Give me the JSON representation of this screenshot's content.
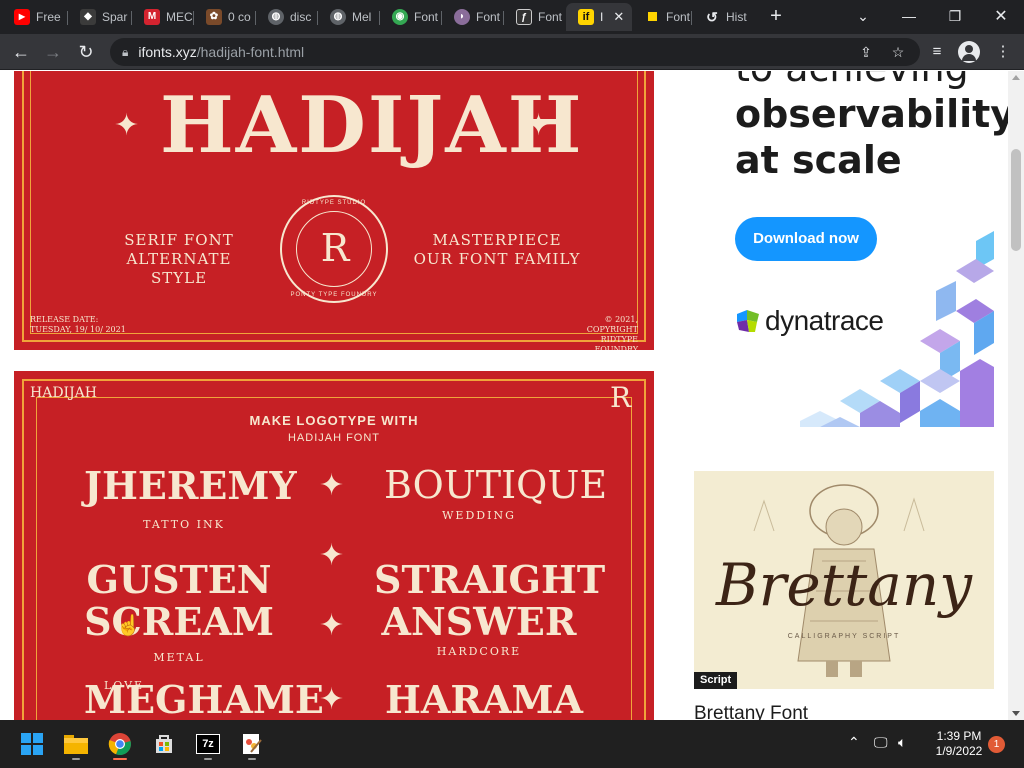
{
  "browser": {
    "tabs": [
      {
        "label": "Free",
        "favicon_color": "#ff0000",
        "favicon_glyph": "▶",
        "icon": "youtube-icon"
      },
      {
        "label": "Spar",
        "favicon_color": "#3b3b3b",
        "favicon_glyph": "◆",
        "icon": "helmet-icon"
      },
      {
        "label": "MEC",
        "favicon_color": "#d4232f",
        "favicon_glyph": "M",
        "icon": "m-logo-icon"
      },
      {
        "label": "0 co",
        "favicon_color": "#7a4a2a",
        "favicon_glyph": "✿",
        "icon": "cookie-icon"
      },
      {
        "label": "disc",
        "favicon_color": "#5f6368",
        "favicon_glyph": "◍",
        "icon": "globe-icon"
      },
      {
        "label": "Mel",
        "favicon_color": "#5f6368",
        "favicon_glyph": "◍",
        "icon": "globe-icon"
      },
      {
        "label": "Font",
        "favicon_color": "#34a853",
        "favicon_glyph": "◉",
        "icon": "maps-pin-icon"
      },
      {
        "label": "Font",
        "favicon_color": "#8a6d9a",
        "favicon_glyph": "◗",
        "icon": "font-site-icon"
      },
      {
        "label": "Font",
        "favicon_color": "#333333",
        "favicon_glyph": "ƒ",
        "icon": "font-site-icon"
      },
      {
        "label": "I",
        "favicon_color": "#ffd400",
        "favicon_glyph": "if",
        "icon": "ifonts-icon",
        "active": true
      },
      {
        "label": "Font",
        "favicon_color": "#ffd400",
        "favicon_glyph": "",
        "icon": "yellow-square-icon"
      },
      {
        "label": "Hist",
        "favicon_color": "#5f6368",
        "favicon_glyph": "↺",
        "icon": "history-icon"
      }
    ],
    "new_tab": "+",
    "url_host": "ifonts.xyz",
    "url_path": "/hadijah-font.html"
  },
  "page": {
    "banner1": {
      "title": "HADIJAH",
      "left_text": [
        "SERIF FONT",
        "ALTERNATE STYLE"
      ],
      "right_text": [
        "MASTERPIECE",
        "OUR FONT FAMILY"
      ],
      "seal_top": "RIDTYPE STUDIO",
      "seal_bottom": "PONTY TYPE FOUNDRY",
      "seal_mono": "R",
      "release": [
        "RELEASE DATE:",
        "TUESDAY, 19/ 10/ 2021"
      ],
      "copyright": [
        "© 2021, COPYRIGHT",
        "RIDTYPE FOUNDRY"
      ]
    },
    "banner2": {
      "corner": "HADIJAH",
      "mono": "R",
      "heading": "MAKE LOGOTYPE WITH",
      "subheading": "HADIJAH FONT",
      "logos": [
        {
          "name": "JHEREMY",
          "sub": "TATTO INK"
        },
        {
          "name": "BOUTIQUE",
          "sub": "WEDDING"
        },
        {
          "name": "GUSTEN",
          "sub": ""
        },
        {
          "name": "SCREAM",
          "sub": "METAL"
        },
        {
          "name": "STRAIGHT",
          "sub": ""
        },
        {
          "name": "ANSWER",
          "sub": "HARDCORE"
        },
        {
          "name": "MEGHAME",
          "sub": "LOVE"
        },
        {
          "name": "HARAMA",
          "sub": ""
        }
      ]
    },
    "ad": {
      "line1": "to achieving",
      "line2": "observability",
      "line3": "at scale",
      "button": "Download now",
      "brand": "dynatrace"
    },
    "card": {
      "script_title": "Brettany",
      "script_sub": "CALLIGRAPHY SCRIPT",
      "badge": "Script",
      "name": "Brettany Font"
    }
  },
  "taskbar": {
    "time": "1:39 PM",
    "date": "1/9/2022",
    "notifications": "1"
  },
  "colors": {
    "banner_red": "#c62025",
    "ad_blue": "#1496ff"
  }
}
